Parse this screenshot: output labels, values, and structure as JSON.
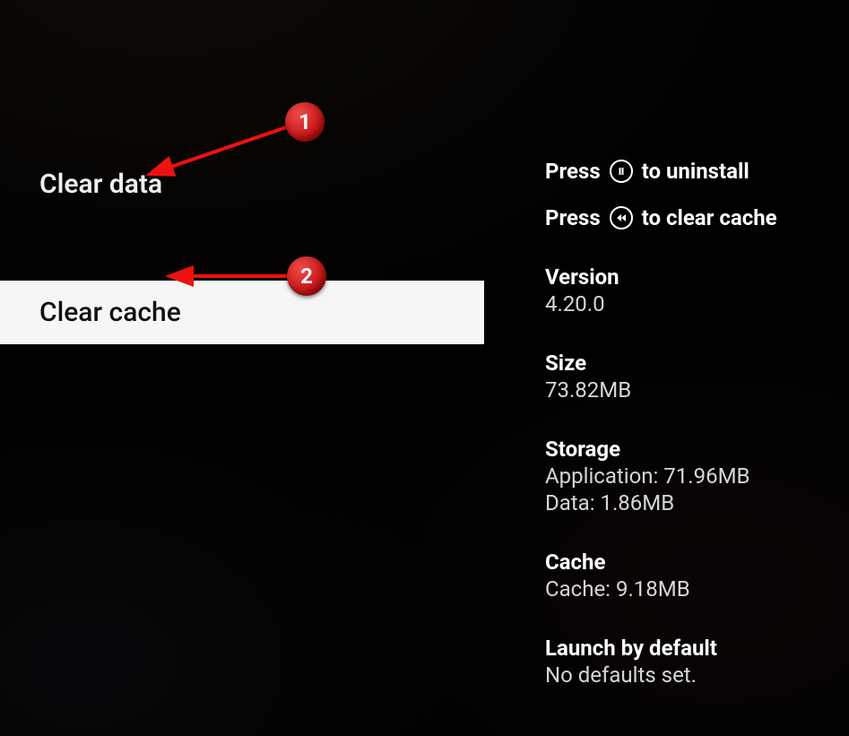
{
  "menu": {
    "items": [
      {
        "label": "Clear data"
      },
      {
        "label": "Clear cache"
      }
    ]
  },
  "hints": {
    "press": "Press",
    "uninstall": "to uninstall",
    "clear_cache": "to clear cache"
  },
  "details": {
    "version": {
      "title": "Version",
      "value": "4.20.0"
    },
    "size": {
      "title": "Size",
      "value": "73.82MB"
    },
    "storage": {
      "title": "Storage",
      "application": "Application: 71.96MB",
      "data": "Data: 1.86MB"
    },
    "cache": {
      "title": "Cache",
      "value": "Cache: 9.18MB"
    },
    "launch": {
      "title": "Launch by default",
      "value": "No defaults set."
    }
  },
  "annotations": {
    "badge1": "1",
    "badge2": "2"
  }
}
